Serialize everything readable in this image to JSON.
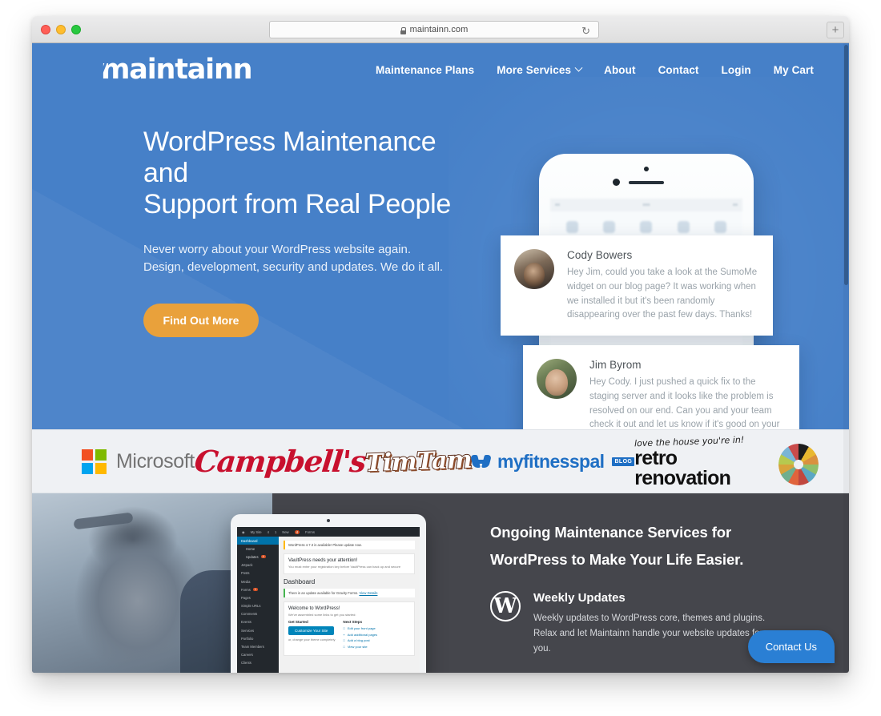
{
  "browser": {
    "url": "maintainn.com",
    "lock_icon": "lock-icon",
    "reload_icon": "reload-icon",
    "newtab_label": "+",
    "traffic_lights": [
      "close",
      "minimize",
      "zoom"
    ]
  },
  "header": {
    "logo": "maintainn",
    "nav": [
      {
        "label": "Maintenance Plans",
        "has_caret": false
      },
      {
        "label": "More Services",
        "has_caret": true
      },
      {
        "label": "About",
        "has_caret": false
      },
      {
        "label": "Contact",
        "has_caret": false
      },
      {
        "label": "Login",
        "has_caret": false
      },
      {
        "label": "My Cart",
        "has_caret": false
      }
    ]
  },
  "hero": {
    "title_line1": "WordPress Maintenance and",
    "title_line2": "Support from Real People",
    "sub_line1": "Never worry about your WordPress website again.",
    "sub_line2": "Design, development, security and updates. We do it all.",
    "cta_label": "Find Out More",
    "background_color": "#4680c8",
    "cta_color": "#e9a13b",
    "chat_cards": [
      {
        "name": "Cody Bowers",
        "message": "Hey  Jim,  could you take a look at the SumoMe widget on our blog page? It was working when we installed it but it's been randomly disappearing over the past few days. Thanks!"
      },
      {
        "name": "Jim Byrom",
        "message": "Hey Cody. I just pushed a quick fix to the staging server and it looks like the problem is resolved on our end. Can you and your team check it out and let us know if it's good on your end?"
      }
    ]
  },
  "logo_strip": {
    "brands": [
      {
        "name": "Microsoft",
        "text": "Microsoft"
      },
      {
        "name": "Campbell's",
        "text": "Campbell's"
      },
      {
        "name": "TimTam",
        "text": "TimTam"
      },
      {
        "name": "myfitnesspal",
        "text": "myfitnesspal",
        "badge": "BLOG"
      },
      {
        "name": "retro renovation",
        "tagline": "love the house you're in!",
        "text": "retro renovation"
      }
    ]
  },
  "services": {
    "title_line1": "Ongoing Maintenance Services for",
    "title_line2": "WordPress to Make Your Life Easier.",
    "background_color": "#45464c",
    "feature": {
      "icon": "wordpress-icon",
      "icon_glyph": "W",
      "title": "Weekly Updates",
      "text": "Weekly updates to WordPress core, themes and plugins. Relax and let Maintainn handle your website updates for you."
    },
    "wp_dashboard": {
      "adminbar": [
        "My Site",
        "4",
        "1",
        "New",
        "4",
        "Forms"
      ],
      "menu": [
        "Dashboard",
        "Home",
        "Updates",
        "Jetpack",
        "Posts",
        "Media",
        "Forms",
        "Pages",
        "Simple URLs",
        "Comments",
        "Events",
        "Services",
        "Portfolio",
        "Team Members",
        "Careers",
        "Clients"
      ],
      "notice_update": "WordPress 4.7.3 is available! Please update now.",
      "notice_update_link": "Please update now.",
      "vaultpress_title": "VaultPress needs your attention!",
      "vaultpress_text": "You must enter your registration key before VaultPress can back up and secure",
      "page_heading": "Dashboard",
      "gravity_notice": "There is an update available for Gravity Forms.",
      "gravity_link": "View Details",
      "welcome_title": "Welcome to WordPress!",
      "welcome_sub": "We've assembled some links to get you started:",
      "get_started_label": "Get Started",
      "customize_button": "Customize Your Site",
      "alt_text": "or, change your theme completely",
      "next_steps_label": "Next Steps",
      "next_steps": [
        "Edit your front page",
        "Add additional pages",
        "Add a blog post",
        "View your site"
      ]
    }
  },
  "contact_widget": {
    "label": "Contact Us",
    "color": "#2a7fd4"
  }
}
